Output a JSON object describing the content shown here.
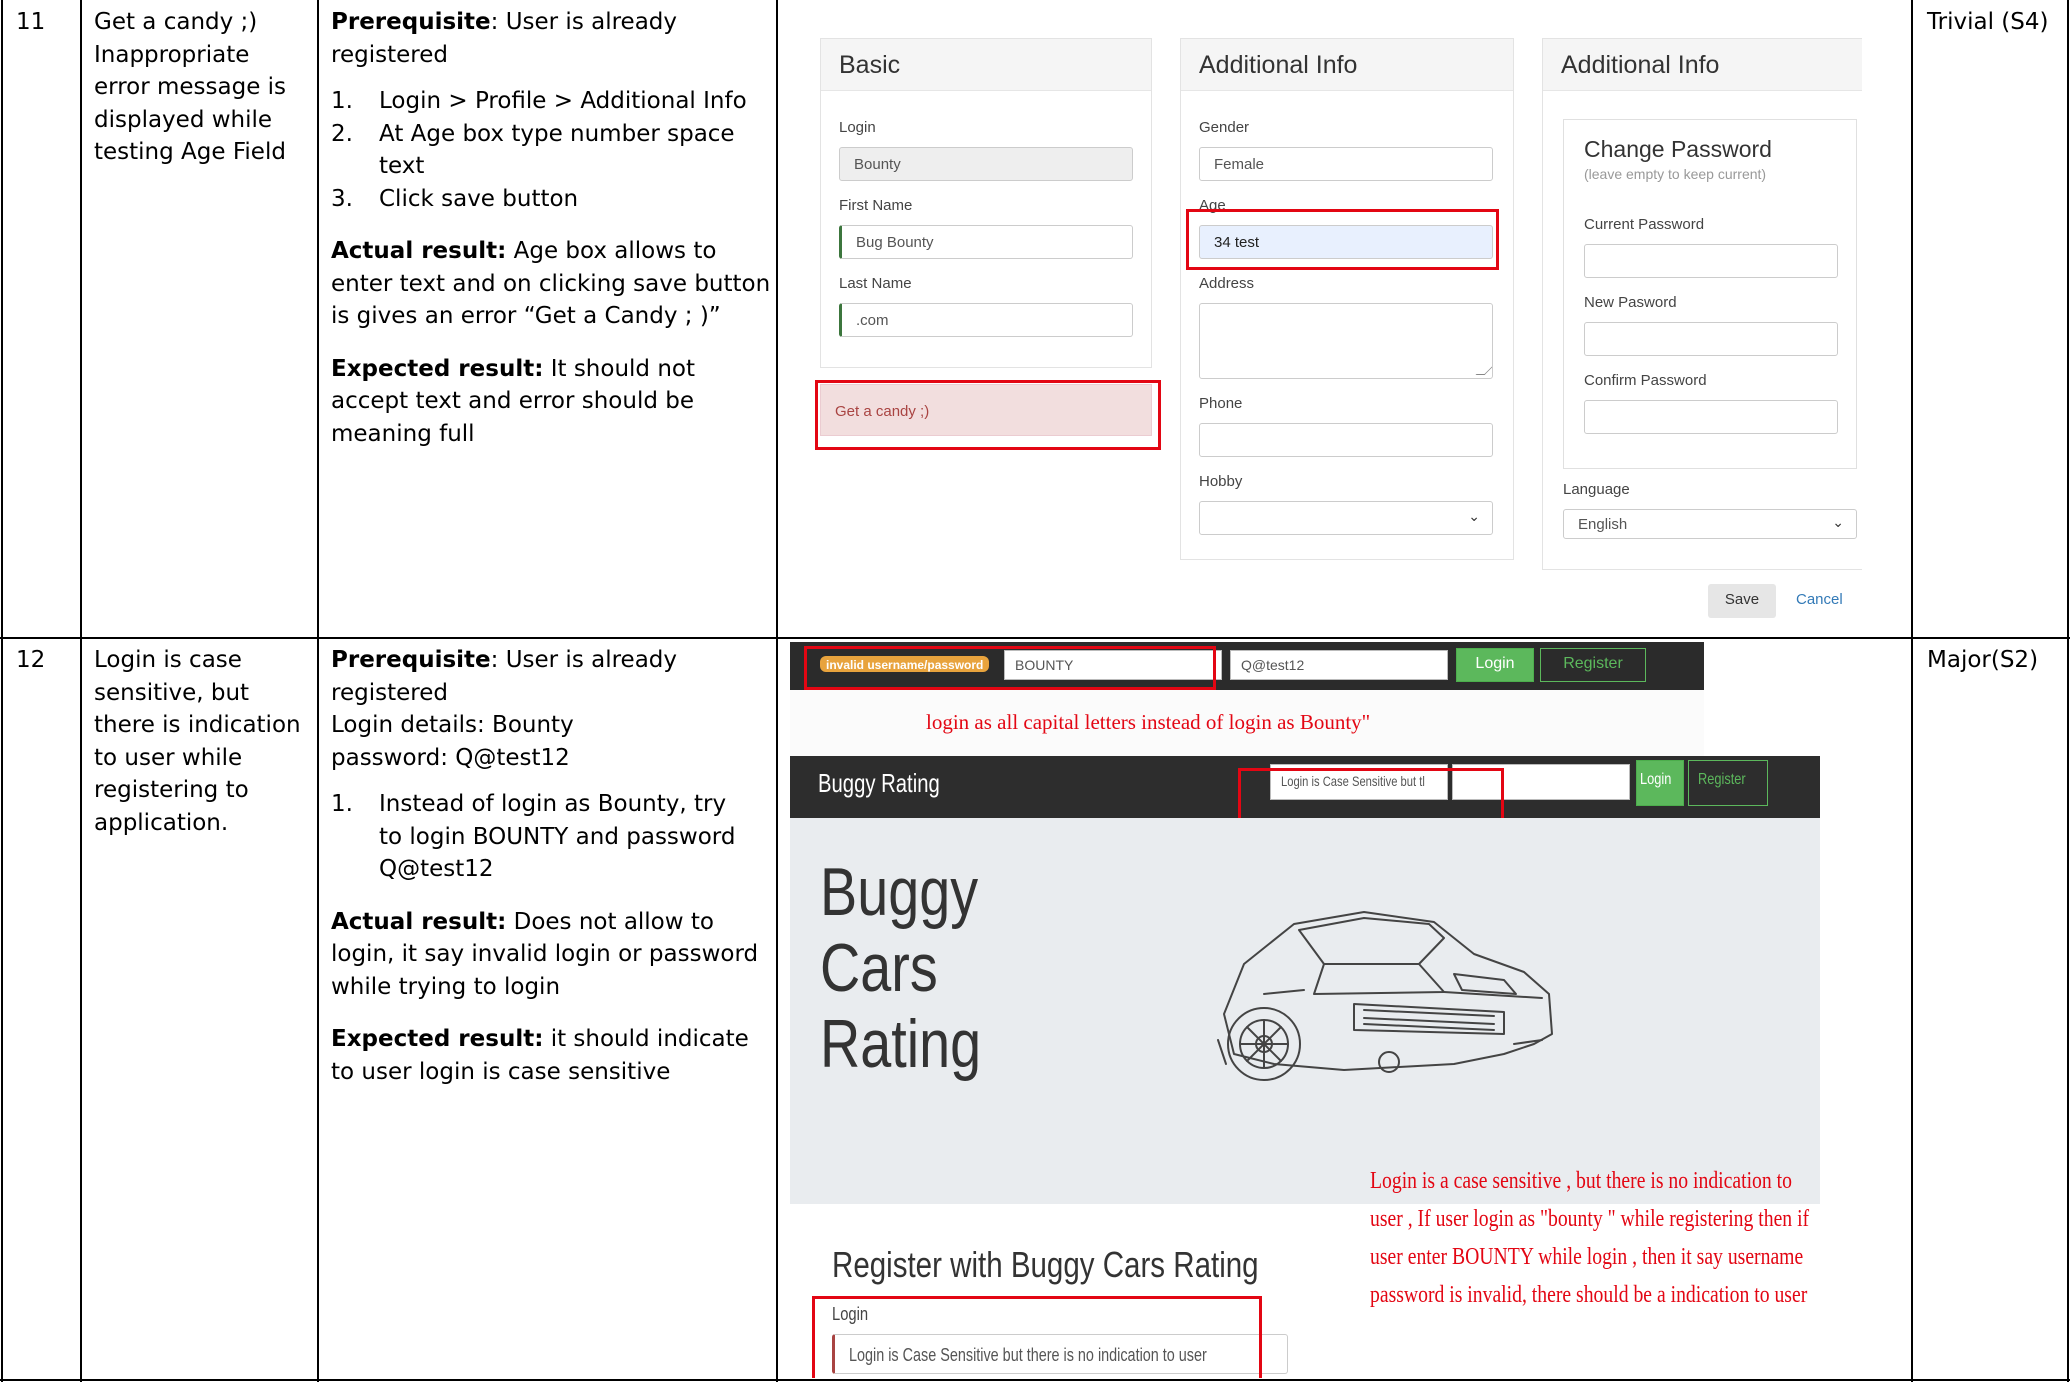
{
  "rows": [
    {
      "id": "11",
      "summary": "Get a candy ;) Inappropriate error message is displayed while testing Age Field",
      "prerequisite_label": "Prerequisite",
      "prerequisite_text": ": User is already registered",
      "login_details": "",
      "steps": [
        {
          "num": "1.",
          "text": "Login > Profile > Additional Info"
        },
        {
          "num": "2.",
          "text": "At Age box type number space text"
        },
        {
          "num": "3.",
          "text": "Click save button"
        }
      ],
      "actual_label": "Actual result:",
      "actual_text": " Age box allows to enter text and on clicking save button is gives an error “Get a Candy ; )”",
      "expected_label": "Expected result:",
      "expected_text": " It should not accept text and error should be meaning full",
      "severity": "Trivial (S4)"
    },
    {
      "id": "12",
      "summary": "Login is case sensitive, but there is indication to user while registering to application.",
      "prerequisite_label": "Prerequisite",
      "prerequisite_text": ": User is already registered",
      "login_details": "Login details: Bounty password: Q@test12",
      "steps": [
        {
          "num": "1.",
          "text": "Instead of login as Bounty, try to login BOUNTY and password Q@test12"
        }
      ],
      "actual_label": "Actual result:",
      "actual_text": "  Does not allow to login, it say invalid login or password while trying to login",
      "expected_label": "Expected result:",
      "expected_text": " it should indicate to user login is case sensitive",
      "severity": "Major(S2)"
    }
  ],
  "shot1": {
    "basic": {
      "title": "Basic",
      "login_label": "Login",
      "login_value": "Bounty",
      "first_name_label": "First Name",
      "first_name_value": "Bug Bounty",
      "last_name_label": "Last Name",
      "last_name_value": ".com"
    },
    "error_alert": "Get a candy ;)",
    "additional": {
      "title": "Additional Info",
      "gender_label": "Gender",
      "gender_value": "Female",
      "age_label": "Age",
      "age_value": "34 test",
      "address_label": "Address",
      "address_value": "",
      "phone_label": "Phone",
      "phone_value": "",
      "hobby_label": "Hobby",
      "hobby_value": ""
    },
    "additional2": {
      "title": "Additional Info",
      "change_password_title": "Change Password",
      "change_password_hint": "(leave empty to keep current)",
      "current_password_label": "Current Password",
      "new_password_label": "New Pasword",
      "confirm_password_label": "Confirm Password",
      "language_label": "Language",
      "language_value": "English"
    },
    "save_label": "Save",
    "cancel_label": "Cancel"
  },
  "shot2": {
    "top_bar": {
      "error_badge": "invalid username/password",
      "login_value": "BOUNTY",
      "password_value": "Q@test12",
      "login_button": "Login",
      "register_button": "Register"
    },
    "annotation_top": "login as all capital letters instead of login as Bounty\"",
    "nav": {
      "brand": "Buggy Rating",
      "login_placeholder": "Login is Case Sensitive but tl",
      "password_value": "",
      "login_button": "Login",
      "register_button": "Register"
    },
    "hero_title_lines": [
      "Buggy",
      "Cars",
      "Rating"
    ],
    "annotation_bottom": "Login is a case sensitive , but there is no indication to user , If user login as \"bounty \" while registering then if user enter BOUNTY while login , then it say username password is invalid, there should be a indication to user",
    "register_title": "Register with Buggy Cars Rating",
    "register_login_label": "Login",
    "register_login_placeholder": "Login is Case Sensitive but there is no indication to user"
  },
  "colors": {
    "highlight_red": "#e30613",
    "button_green": "#5cb85c",
    "navbar_dark": "#2b2b2b",
    "alert_bg": "#f2dede",
    "badge_orange": "#e8a33d"
  }
}
